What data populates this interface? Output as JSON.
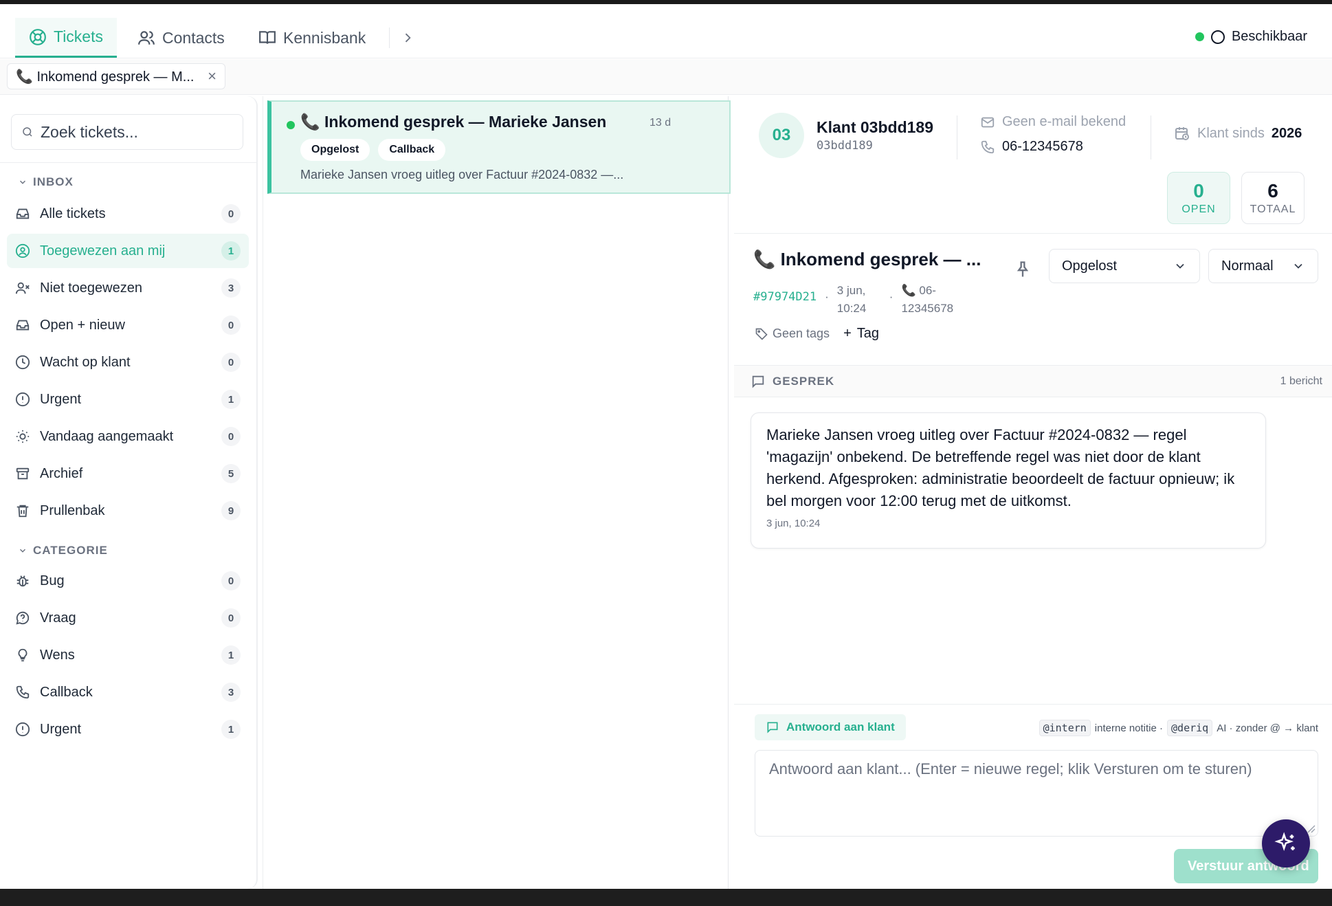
{
  "nav": {
    "tabs": [
      {
        "label": "Tickets",
        "icon": "lifebuoy-icon"
      },
      {
        "label": "Contacts",
        "icon": "users-icon"
      },
      {
        "label": "Kennisbank",
        "icon": "book-icon"
      }
    ],
    "status_label": "Beschikbaar"
  },
  "open_tab": {
    "label": "📞 Inkomend gesprek — M..."
  },
  "sidebar": {
    "search_placeholder": "Zoek tickets...",
    "inbox_title": "INBOX",
    "inbox": [
      {
        "label": "Alle tickets",
        "count": "0"
      },
      {
        "label": "Toegewezen aan mij",
        "count": "1"
      },
      {
        "label": "Niet toegewezen",
        "count": "3"
      },
      {
        "label": "Open + nieuw",
        "count": "0"
      },
      {
        "label": "Wacht op klant",
        "count": "0"
      },
      {
        "label": "Urgent",
        "count": "1"
      },
      {
        "label": "Vandaag aangemaakt",
        "count": "0"
      },
      {
        "label": "Archief",
        "count": "5"
      },
      {
        "label": "Prullenbak",
        "count": "9"
      }
    ],
    "category_title": "CATEGORIE",
    "categories": [
      {
        "label": "Bug",
        "count": "0"
      },
      {
        "label": "Vraag",
        "count": "0"
      },
      {
        "label": "Wens",
        "count": "1"
      },
      {
        "label": "Callback",
        "count": "3"
      },
      {
        "label": "Urgent",
        "count": "1"
      }
    ]
  },
  "ticket_list": {
    "items": [
      {
        "title": "📞 Inkomend gesprek — Marieke Jansen",
        "age": "13 d",
        "tags": [
          "Opgelost",
          "Callback"
        ],
        "preview": "Marieke Jansen vroeg uitleg over Factuur #2024-0832 —..."
      }
    ]
  },
  "customer": {
    "initials": "03",
    "name": "Klant 03bdd189",
    "id": "03bdd189",
    "email": "Geen e-mail bekend",
    "phone": "06-12345678",
    "since_label": "Klant sinds",
    "since_year": "2026",
    "open_count": "0",
    "open_label": "OPEN",
    "total_count": "6",
    "total_label": "TOTAAL"
  },
  "ticket": {
    "title": "📞 Inkomend gesprek — ...",
    "id": "#97974D21",
    "date": "3 jun, 10:24",
    "phone": "📞 06-12345678",
    "status": "Opgelost",
    "priority": "Normaal",
    "no_tags": "Geen tags",
    "add_tag": "Tag"
  },
  "conversation": {
    "title": "GESPREK",
    "count": "1 bericht",
    "messages": [
      {
        "body": "Marieke Jansen vroeg uitleg over Factuur #2024-0832 — regel 'magazijn' onbekend. De betreffende regel was niet door de klant herkend. Afgesproken: administratie beoordeelt de factuur opnieuw; ik bel morgen voor 12:00 terug met de uitkomst.",
        "time": "3 jun, 10:24"
      }
    ]
  },
  "reply": {
    "mode": "Antwoord aan klant",
    "hint_intern_code": "@intern",
    "hint_intern": "interne notitie ·",
    "hint_deriq_code": "@deriq",
    "hint_deriq": "AI · zonder @ → klant",
    "placeholder": "Antwoord aan klant... (Enter = nieuwe regel; klik Versturen om te sturen)",
    "send_label": "Verstuur antwoord"
  },
  "colors": {
    "accent": "#27b08f",
    "fab": "#2d1b69",
    "status_online": "#22c55e"
  }
}
